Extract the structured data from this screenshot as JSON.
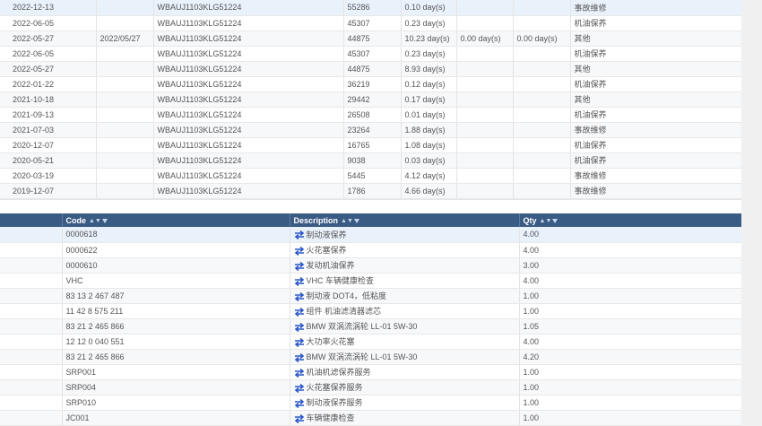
{
  "history": {
    "rows": [
      {
        "date": "2022-12-13",
        "date2": "",
        "vin": "WBAUJ1103KLG51224",
        "mileage": "55286",
        "days1": "0.10 day(s)",
        "days2": "",
        "days3": "",
        "type": "事故维修"
      },
      {
        "date": "2022-06-05",
        "date2": "",
        "vin": "WBAUJ1103KLG51224",
        "mileage": "45307",
        "days1": "0.23 day(s)",
        "days2": "",
        "days3": "",
        "type": "机油保养"
      },
      {
        "date": "2022-05-27",
        "date2": "2022/05/27",
        "vin": "WBAUJ1103KLG51224",
        "mileage": "44875",
        "days1": "10.23 day(s)",
        "days2": "0.00 day(s)",
        "days3": "0.00 day(s)",
        "type": "其他"
      },
      {
        "date": "2022-06-05",
        "date2": "",
        "vin": "WBAUJ1103KLG51224",
        "mileage": "45307",
        "days1": "0.23 day(s)",
        "days2": "",
        "days3": "",
        "type": "机油保养"
      },
      {
        "date": "2022-05-27",
        "date2": "",
        "vin": "WBAUJ1103KLG51224",
        "mileage": "44875",
        "days1": "8.93 day(s)",
        "days2": "",
        "days3": "",
        "type": "其他"
      },
      {
        "date": "2022-01-22",
        "date2": "",
        "vin": "WBAUJ1103KLG51224",
        "mileage": "36219",
        "days1": "0.12 day(s)",
        "days2": "",
        "days3": "",
        "type": "机油保养"
      },
      {
        "date": "2021-10-18",
        "date2": "",
        "vin": "WBAUJ1103KLG51224",
        "mileage": "29442",
        "days1": "0.17 day(s)",
        "days2": "",
        "days3": "",
        "type": "其他"
      },
      {
        "date": "2021-09-13",
        "date2": "",
        "vin": "WBAUJ1103KLG51224",
        "mileage": "26508",
        "days1": "0.01 day(s)",
        "days2": "",
        "days3": "",
        "type": "机油保养"
      },
      {
        "date": "2021-07-03",
        "date2": "",
        "vin": "WBAUJ1103KLG51224",
        "mileage": "23264",
        "days1": "1.88 day(s)",
        "days2": "",
        "days3": "",
        "type": "事故维修"
      },
      {
        "date": "2020-12-07",
        "date2": "",
        "vin": "WBAUJ1103KLG51224",
        "mileage": "16765",
        "days1": "1.08 day(s)",
        "days2": "",
        "days3": "",
        "type": "机油保养"
      },
      {
        "date": "2020-05-21",
        "date2": "",
        "vin": "WBAUJ1103KLG51224",
        "mileage": "9038",
        "days1": "0.03 day(s)",
        "days2": "",
        "days3": "",
        "type": "机油保养"
      },
      {
        "date": "2020-03-19",
        "date2": "",
        "vin": "WBAUJ1103KLG51224",
        "mileage": "5445",
        "days1": "4.12 day(s)",
        "days2": "",
        "days3": "",
        "type": "事故维修"
      },
      {
        "date": "2019-12-07",
        "date2": "",
        "vin": "WBAUJ1103KLG51224",
        "mileage": "1786",
        "days1": "4.66 day(s)",
        "days2": "",
        "days3": "",
        "type": "事故维修"
      }
    ]
  },
  "parts": {
    "columns": {
      "code": "Code",
      "description": "Description",
      "qty": "Qty"
    },
    "rows": [
      {
        "code": "0000618",
        "description": "制动液保养",
        "qty": "4.00"
      },
      {
        "code": "0000622",
        "description": "火花塞保养",
        "qty": "4.00"
      },
      {
        "code": "0000610",
        "description": "发动机油保养",
        "qty": "3.00"
      },
      {
        "code": "VHC",
        "description": "VHC 车辆健康检查",
        "qty": "4.00"
      },
      {
        "code": "83 13 2 467 487",
        "description": "制动液 DOT4，低粘度",
        "qty": "1.00"
      },
      {
        "code": "11 42 8 575 211",
        "description": "组件 机油滤清器滤芯",
        "qty": "1.00"
      },
      {
        "code": "83 21 2 465 866",
        "description": "BMW 双涡流涡轮 LL-01 5W-30",
        "qty": "1.05"
      },
      {
        "code": "12 12 0 040 551",
        "description": "大功率火花塞",
        "qty": "4.00"
      },
      {
        "code": "83 21 2 465 866",
        "description": "BMW 双涡流涡轮 LL-01 5W-30",
        "qty": "4.20"
      },
      {
        "code": "SRP001",
        "description": "机油机滤保养服务",
        "qty": "1.00"
      },
      {
        "code": "SRP004",
        "description": "火花塞保养服务",
        "qty": "1.00"
      },
      {
        "code": "SRP010",
        "description": "制动液保养服务",
        "qty": "1.00"
      },
      {
        "code": "JC001",
        "description": "车辆健康检查",
        "qty": "1.00"
      }
    ]
  },
  "colors": {
    "header_bg": "#3a5b84",
    "swap_icon": "#2a57c8"
  }
}
